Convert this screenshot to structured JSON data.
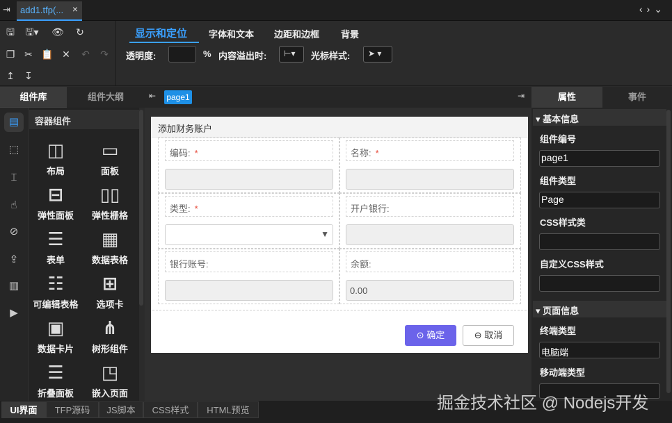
{
  "file_tab": {
    "label": "add1.tfp(...",
    "close": "×"
  },
  "toolbar": {
    "prop_tabs": [
      "显示和定位",
      "字体和文本",
      "边距和边框",
      "背景"
    ],
    "opacity_label": "透明度:",
    "opacity_unit": "%",
    "overflow_label": "内容溢出时:",
    "cursor_label": "光标样式:"
  },
  "left_panel": {
    "tabs": [
      "组件库",
      "组件大纲"
    ],
    "section": "容器组件",
    "components": [
      "布局",
      "面板",
      "弹性面板",
      "弹性栅格",
      "表单",
      "数据表格",
      "可编辑表格",
      "选项卡",
      "数据卡片",
      "树形组件",
      "折叠面板",
      "嵌入页面"
    ]
  },
  "canvas": {
    "page_tab": "page1",
    "form_title": "添加财务账户",
    "fields": [
      {
        "label": "编码:",
        "required": "*",
        "value": ""
      },
      {
        "label": "名称:",
        "required": "*",
        "value": ""
      },
      {
        "label": "类型:",
        "required": "*",
        "value": ""
      },
      {
        "label": "开户银行:",
        "required": "",
        "value": ""
      },
      {
        "label": "银行账号:",
        "required": "",
        "value": ""
      },
      {
        "label": "余额:",
        "required": "",
        "value": "0.00"
      }
    ],
    "ok": "确定",
    "cancel": "取消"
  },
  "right_panel": {
    "tabs": [
      "属性",
      "事件"
    ],
    "basic_section": "基本信息",
    "comp_id_label": "组件编号",
    "comp_id": "page1",
    "comp_type_label": "组件类型",
    "comp_type": "Page",
    "css_class_label": "CSS样式类",
    "css_class": "",
    "custom_css_label": "自定义CSS样式",
    "custom_css": "",
    "page_section": "页面信息",
    "terminal_label": "终端类型",
    "terminal": "电脑端",
    "mobile_label": "移动端类型",
    "mobile": ""
  },
  "bottom_tabs": [
    "UI界面",
    "TFP源码",
    "JS脚本",
    "CSS样式",
    "HTML预览"
  ],
  "watermark": "掘金技术社区 @ Nodejs开发",
  "colors": {
    "accent": "#3aa0ff",
    "primary_button": "#6b63ea",
    "required": "#e74c3c"
  }
}
